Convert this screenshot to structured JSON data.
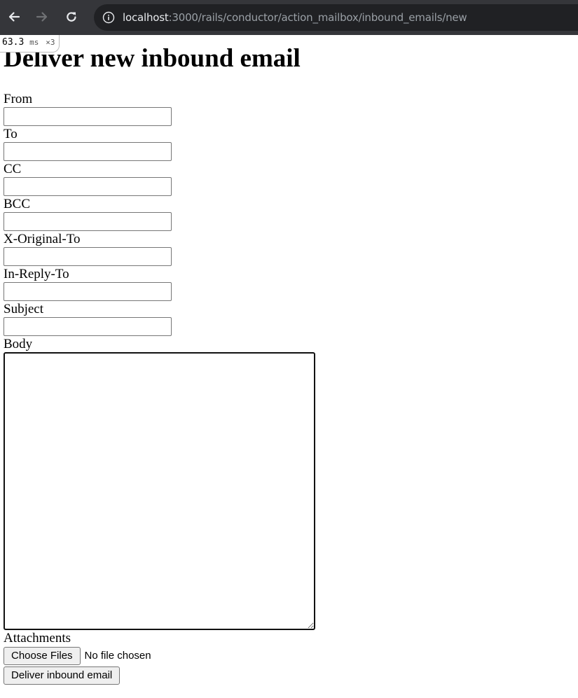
{
  "browser": {
    "url_host": "localhost",
    "url_path": ":3000/rails/conductor/action_mailbox/inbound_emails/new"
  },
  "profiler": {
    "time": "63.3",
    "unit": "ms",
    "count": "×3"
  },
  "page": {
    "title": "Deliver new inbound email"
  },
  "form": {
    "fields": [
      {
        "label": "From",
        "value": ""
      },
      {
        "label": "To",
        "value": ""
      },
      {
        "label": "CC",
        "value": ""
      },
      {
        "label": "BCC",
        "value": ""
      },
      {
        "label": "X-Original-To",
        "value": ""
      },
      {
        "label": "In-Reply-To",
        "value": ""
      },
      {
        "label": "Subject",
        "value": ""
      }
    ],
    "body_label": "Body",
    "body_value": "",
    "attachments_label": "Attachments",
    "choose_files_label": "Choose Files",
    "file_status": "No file chosen",
    "submit_label": "Deliver inbound email"
  }
}
